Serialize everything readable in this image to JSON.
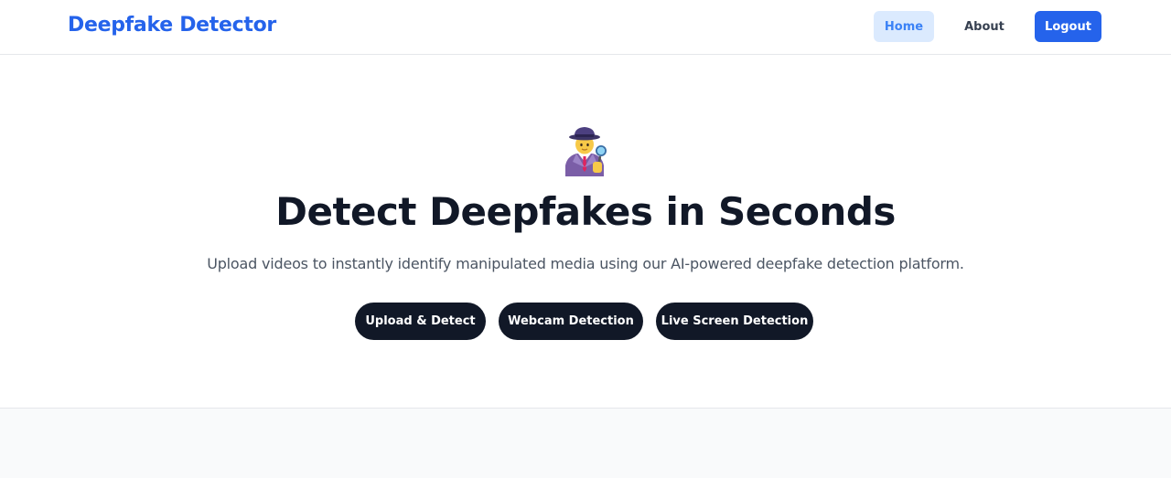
{
  "nav": {
    "brand": "Deepfake Detector",
    "home_label": "Home",
    "about_label": "About",
    "logout_label": "Logout",
    "active_item": "Home"
  },
  "hero": {
    "icon": "detective-icon",
    "title": "Detect Deepfakes in Seconds",
    "subtitle": "Upload videos to instantly identify manipulated media using our AI-powered deepfake detection platform.",
    "buttons": [
      {
        "label": "Upload & Detect"
      },
      {
        "label": "Webcam Detection"
      },
      {
        "label": "Live Screen Detection"
      }
    ]
  },
  "colors": {
    "brand": "#2563eb",
    "nav_active_bg": "#dbeafe",
    "cta_bg": "#111827",
    "lower_bg": "#f9fafb"
  }
}
